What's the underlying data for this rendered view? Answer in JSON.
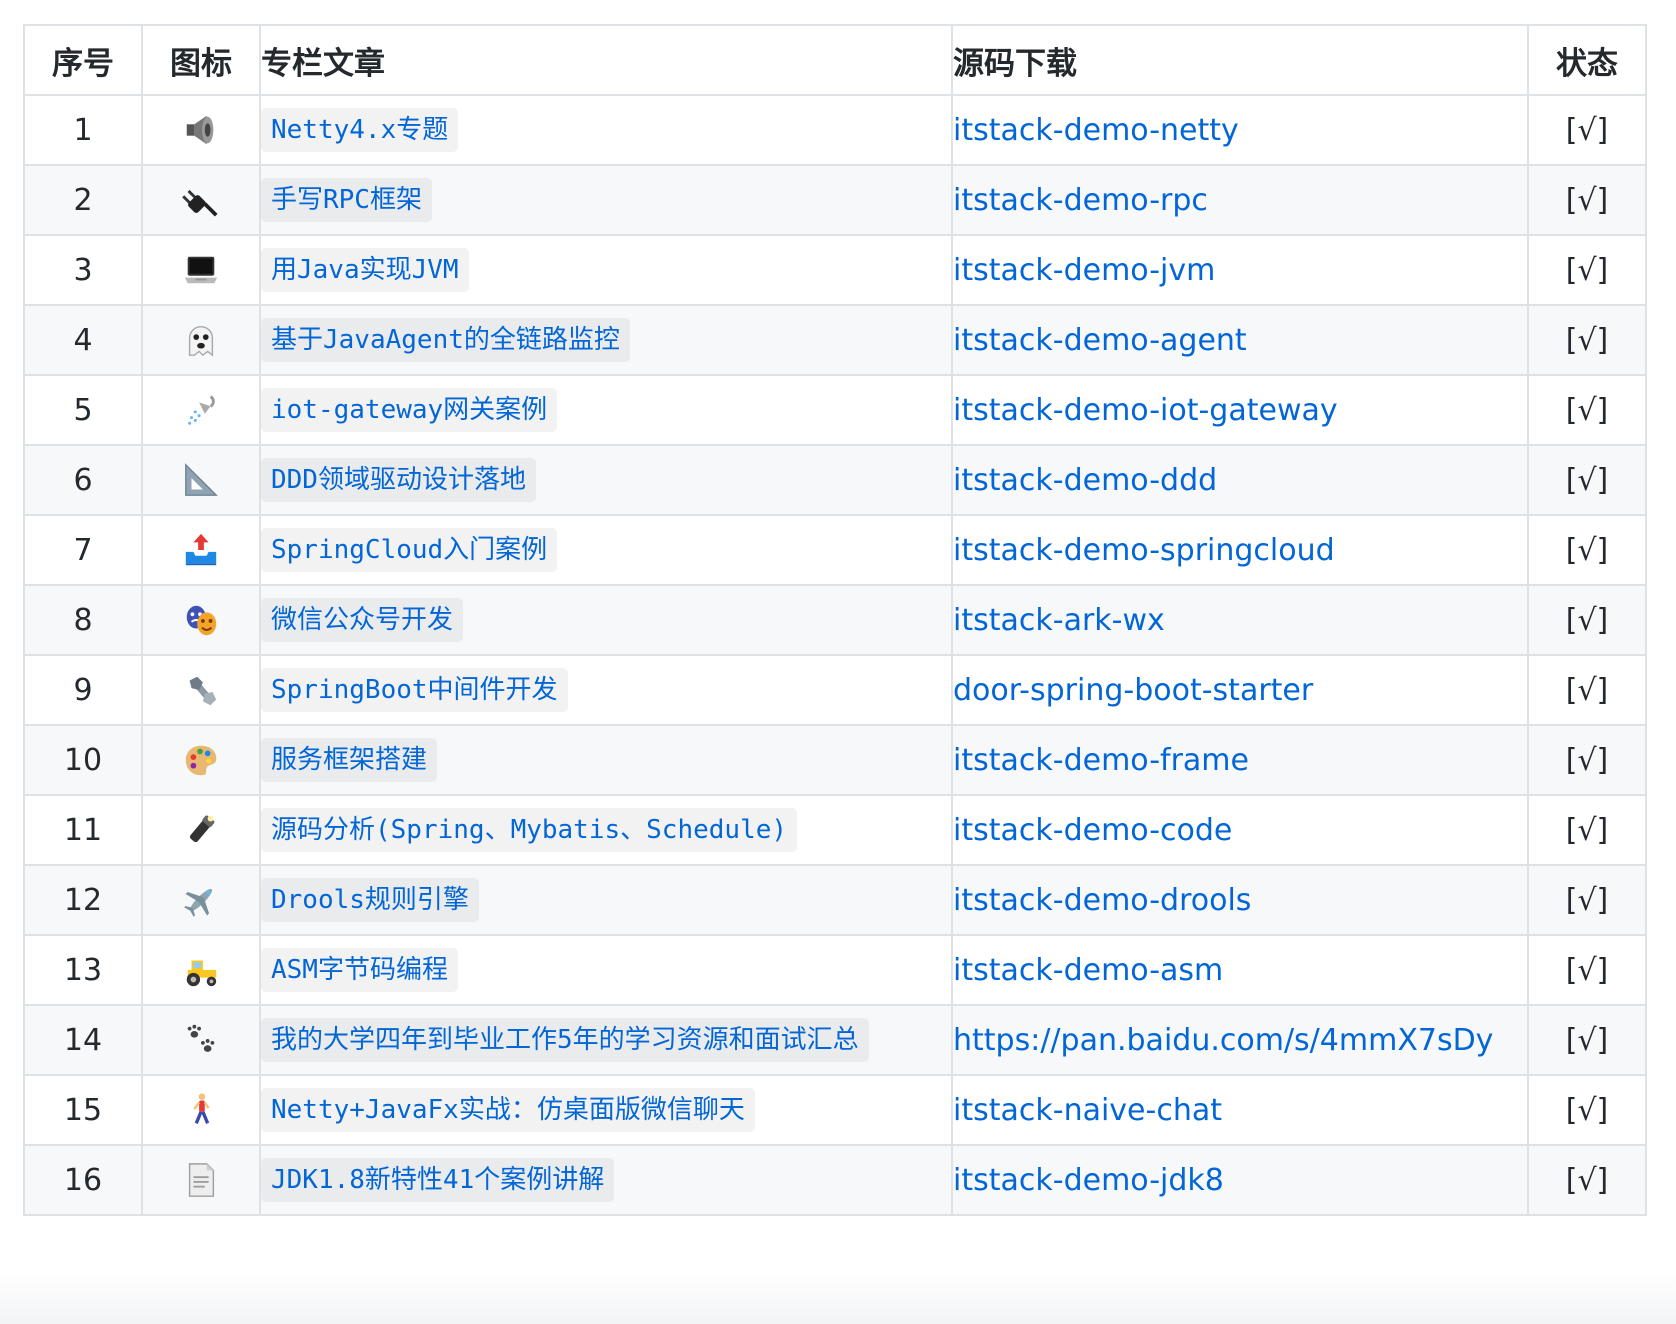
{
  "headers": {
    "num": "序号",
    "icon": "图标",
    "article": "专栏文章",
    "repo": "源码下载",
    "status": "状态"
  },
  "rows": [
    {
      "num": "1",
      "icon": "speaker-icon",
      "article": "Netty4.x专题",
      "repo": "itstack-demo-netty",
      "status": "[√]"
    },
    {
      "num": "2",
      "icon": "electric-plug-icon",
      "article": "手写RPC框架",
      "repo": "itstack-demo-rpc",
      "status": "[√]"
    },
    {
      "num": "3",
      "icon": "laptop-icon",
      "article": "用Java实现JVM",
      "repo": "itstack-demo-jvm",
      "status": "[√]"
    },
    {
      "num": "4",
      "icon": "ghost-icon",
      "article": "基于JavaAgent的全链路监控",
      "repo": "itstack-demo-agent",
      "status": "[√]"
    },
    {
      "num": "5",
      "icon": "shower-icon",
      "article": "iot-gateway网关案例",
      "repo": "itstack-demo-iot-gateway",
      "status": "[√]"
    },
    {
      "num": "6",
      "icon": "triangular-ruler-icon",
      "article": "DDD领域驱动设计落地",
      "repo": "itstack-demo-ddd",
      "status": "[√]"
    },
    {
      "num": "7",
      "icon": "outbox-tray-icon",
      "article": "SpringCloud入门案例",
      "repo": "itstack-demo-springcloud",
      "status": "[√]"
    },
    {
      "num": "8",
      "icon": "performing-arts-icon",
      "article": "微信公众号开发",
      "repo": "itstack-ark-wx",
      "status": "[√]"
    },
    {
      "num": "9",
      "icon": "nut-and-bolt-icon",
      "article": "SpringBoot中间件开发",
      "repo": "door-spring-boot-starter",
      "status": "[√]"
    },
    {
      "num": "10",
      "icon": "palette-icon",
      "article": "服务框架搭建",
      "repo": "itstack-demo-frame",
      "status": "[√]"
    },
    {
      "num": "11",
      "icon": "flashlight-icon",
      "article": "源码分析(Spring、Mybatis、Schedule)",
      "repo": "itstack-demo-code",
      "status": "[√]"
    },
    {
      "num": "12",
      "icon": "airplane-icon",
      "article": "Drools规则引擎",
      "repo": "itstack-demo-drools",
      "status": "[√]"
    },
    {
      "num": "13",
      "icon": "tractor-icon",
      "article": "ASM字节码编程",
      "repo": "itstack-demo-asm",
      "status": "[√]"
    },
    {
      "num": "14",
      "icon": "paw-prints-icon",
      "article": "我的大学四年到毕业工作5年的学习资源和面试汇总",
      "repo": "https://pan.baidu.com/s/4mmX7sDy",
      "status": "[√]"
    },
    {
      "num": "15",
      "icon": "walking-person-icon",
      "article": "Netty+JavaFx实战：仿桌面版微信聊天",
      "repo": "itstack-naive-chat",
      "status": "[√]"
    },
    {
      "num": "16",
      "icon": "page-facing-up-icon",
      "article": "JDK1.8新特性41个案例讲解",
      "repo": "itstack-demo-jdk8",
      "status": "[√]"
    }
  ]
}
